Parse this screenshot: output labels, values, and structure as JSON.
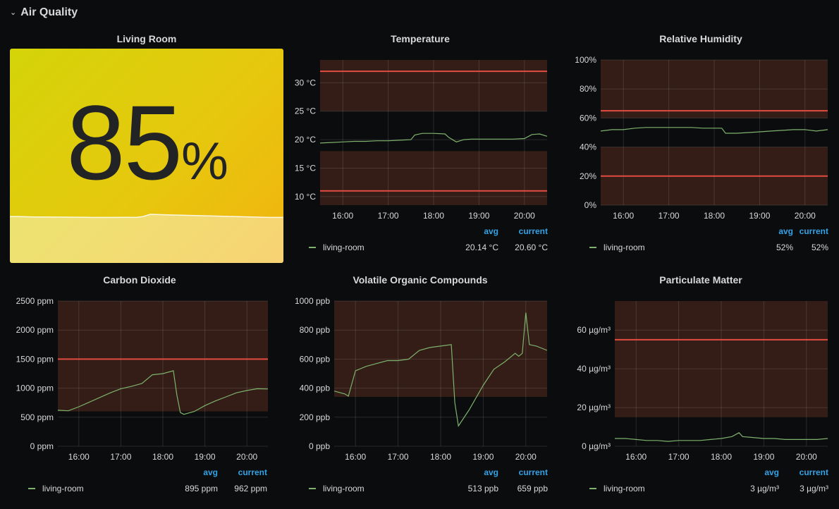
{
  "row": {
    "title": "Air Quality",
    "chevron_icon": "chevron-down-icon"
  },
  "colors": {
    "series": "#7eb26d",
    "threshold_line": "#e24d42",
    "threshold_fill": "rgba(234,112,60,0.18)",
    "legend_header": "#33a2e5"
  },
  "singlestat": {
    "title": "Living Room",
    "value": "85",
    "unit": "%",
    "sparkline": [
      52,
      52,
      51.8,
      51.6,
      51.5,
      51.5,
      51.4,
      51.4,
      51.3,
      51.2,
      51.2,
      51.1,
      51,
      51,
      51,
      51,
      51.1,
      51.1,
      51,
      52,
      54.5,
      54.2,
      54,
      53.8,
      53.6,
      53.4,
      53.2,
      53,
      52.8,
      52.6,
      52.4,
      52.2,
      52,
      51.8,
      51.6,
      51.4,
      51.2,
      51,
      51,
      51
    ]
  },
  "panels": [
    {
      "id": "temperature",
      "title": "Temperature",
      "legend": {
        "avg_label": "avg",
        "current_label": "current",
        "series": "living-room",
        "avg": "20.14 °C",
        "current": "20.60 °C"
      }
    },
    {
      "id": "humidity",
      "title": "Relative Humidity",
      "legend": {
        "avg_label": "avg",
        "current_label": "current",
        "series": "living-room",
        "avg": "52%",
        "current": "52%"
      }
    },
    {
      "id": "co2",
      "title": "Carbon Dioxide",
      "legend": {
        "avg_label": "avg",
        "current_label": "current",
        "series": "living-room",
        "avg": "895 ppm",
        "current": "962 ppm"
      }
    },
    {
      "id": "voc",
      "title": "Volatile Organic Compounds",
      "legend": {
        "avg_label": "avg",
        "current_label": "current",
        "series": "living-room",
        "avg": "513 ppb",
        "current": "659 ppb"
      }
    },
    {
      "id": "pm",
      "title": "Particulate Matter",
      "legend": {
        "avg_label": "avg",
        "current_label": "current",
        "series": "living-room",
        "avg": "3 µg/m³",
        "current": "3 µg/m³"
      }
    }
  ],
  "chart_data": [
    {
      "type": "line",
      "title": "Temperature",
      "x": [
        "15:30",
        "15:45",
        "16:00",
        "16:15",
        "16:30",
        "16:45",
        "17:00",
        "17:15",
        "17:30",
        "17:35",
        "17:45",
        "18:00",
        "18:15",
        "18:20",
        "18:30",
        "18:40",
        "18:50",
        "19:00",
        "19:15",
        "19:30",
        "19:45",
        "20:00",
        "20:10",
        "20:20",
        "20:30"
      ],
      "series": [
        {
          "name": "living-room",
          "values": [
            19.4,
            19.5,
            19.6,
            19.7,
            19.7,
            19.8,
            19.8,
            19.9,
            20.0,
            20.8,
            21.1,
            21.1,
            21.0,
            20.4,
            19.6,
            20.0,
            20.1,
            20.1,
            20.1,
            20.1,
            20.1,
            20.2,
            20.9,
            21.0,
            20.6
          ]
        }
      ],
      "y_ticks": [
        "30 °C",
        "25 °C",
        "20 °C",
        "15 °C",
        "10 °C"
      ],
      "x_ticks": [
        "16:00",
        "17:00",
        "18:00",
        "19:00",
        "20:00"
      ],
      "ylim": [
        8.5,
        34
      ],
      "thresholds": [
        32,
        11
      ],
      "threshold_regions": [
        [
          25,
          34
        ],
        [
          8.5,
          18
        ]
      ],
      "grid": true
    },
    {
      "type": "line",
      "title": "Relative Humidity",
      "x": [
        "15:30",
        "15:45",
        "16:00",
        "16:15",
        "16:30",
        "16:45",
        "17:00",
        "17:15",
        "17:30",
        "17:45",
        "18:00",
        "18:10",
        "18:15",
        "18:30",
        "18:45",
        "19:00",
        "19:15",
        "19:30",
        "19:45",
        "20:00",
        "20:15",
        "20:30"
      ],
      "series": [
        {
          "name": "living-room",
          "values": [
            51,
            52,
            52,
            53,
            53.5,
            53.5,
            53.5,
            53.5,
            53.5,
            53,
            53,
            53,
            49.5,
            49.5,
            50,
            50.5,
            51,
            51.5,
            52,
            52,
            51,
            52
          ]
        }
      ],
      "y_ticks": [
        "100%",
        "80%",
        "60%",
        "40%",
        "20%",
        "0%"
      ],
      "x_ticks": [
        "16:00",
        "17:00",
        "18:00",
        "19:00",
        "20:00"
      ],
      "ylim": [
        0,
        100
      ],
      "thresholds": [
        65,
        20
      ],
      "threshold_regions": [
        [
          60,
          100
        ],
        [
          0,
          40
        ]
      ],
      "grid": true
    },
    {
      "type": "line",
      "title": "Carbon Dioxide",
      "x": [
        "15:30",
        "15:45",
        "16:00",
        "16:15",
        "16:30",
        "16:45",
        "17:00",
        "17:15",
        "17:30",
        "17:45",
        "18:00",
        "18:15",
        "18:20",
        "18:25",
        "18:30",
        "18:45",
        "19:00",
        "19:15",
        "19:30",
        "19:45",
        "20:00",
        "20:15",
        "20:30"
      ],
      "series": [
        {
          "name": "living-room",
          "values": [
            620,
            610,
            680,
            760,
            840,
            920,
            990,
            1030,
            1080,
            1230,
            1250,
            1300,
            880,
            580,
            550,
            600,
            700,
            780,
            850,
            920,
            960,
            990,
            985
          ]
        }
      ],
      "y_ticks": [
        "2500 ppm",
        "2000 ppm",
        "1500 ppm",
        "1000 ppm",
        "500 ppm",
        "0 ppm"
      ],
      "x_ticks": [
        "16:00",
        "17:00",
        "18:00",
        "19:00",
        "20:00"
      ],
      "ylim": [
        0,
        2500
      ],
      "thresholds": [
        1500
      ],
      "threshold_regions": [
        [
          600,
          2500
        ]
      ],
      "grid": true
    },
    {
      "type": "line",
      "title": "Volatile Organic Compounds",
      "x": [
        "15:30",
        "15:45",
        "15:50",
        "16:00",
        "16:15",
        "16:30",
        "16:45",
        "17:00",
        "17:15",
        "17:30",
        "17:45",
        "18:00",
        "18:15",
        "18:20",
        "18:25",
        "18:40",
        "19:00",
        "19:15",
        "19:30",
        "19:45",
        "19:50",
        "19:55",
        "20:00",
        "20:05",
        "20:15",
        "20:30"
      ],
      "series": [
        {
          "name": "living-room",
          "values": [
            380,
            360,
            345,
            520,
            550,
            570,
            590,
            590,
            600,
            660,
            680,
            690,
            700,
            300,
            140,
            250,
            420,
            530,
            580,
            640,
            620,
            640,
            920,
            700,
            690,
            660
          ]
        }
      ],
      "y_ticks": [
        "1000 ppb",
        "800 ppb",
        "600 ppb",
        "400 ppb",
        "200 ppb",
        "0 ppb"
      ],
      "x_ticks": [
        "16:00",
        "17:00",
        "18:00",
        "19:00",
        "20:00"
      ],
      "ylim": [
        0,
        1000
      ],
      "thresholds": [],
      "threshold_regions": [
        [
          340,
          1000
        ]
      ],
      "grid": true
    },
    {
      "type": "line",
      "title": "Particulate Matter",
      "x": [
        "15:30",
        "15:45",
        "16:00",
        "16:15",
        "16:30",
        "16:45",
        "17:00",
        "17:15",
        "17:30",
        "17:45",
        "18:00",
        "18:15",
        "18:25",
        "18:30",
        "18:45",
        "19:00",
        "19:15",
        "19:30",
        "19:45",
        "20:00",
        "20:15",
        "20:30"
      ],
      "series": [
        {
          "name": "living-room",
          "values": [
            4,
            4,
            3.5,
            3,
            3,
            2.5,
            3,
            3,
            3,
            3.5,
            4,
            5,
            7,
            5,
            4.5,
            4,
            4,
            3.5,
            3.5,
            3.5,
            3.5,
            4
          ]
        }
      ],
      "y_ticks": [
        "60 µg/m³",
        "40 µg/m³",
        "20 µg/m³",
        "0 µg/m³"
      ],
      "x_ticks": [
        "16:00",
        "17:00",
        "18:00",
        "19:00",
        "20:00"
      ],
      "ylim": [
        0,
        75
      ],
      "thresholds": [
        55
      ],
      "threshold_regions": [
        [
          15,
          75
        ]
      ],
      "grid": true
    }
  ]
}
